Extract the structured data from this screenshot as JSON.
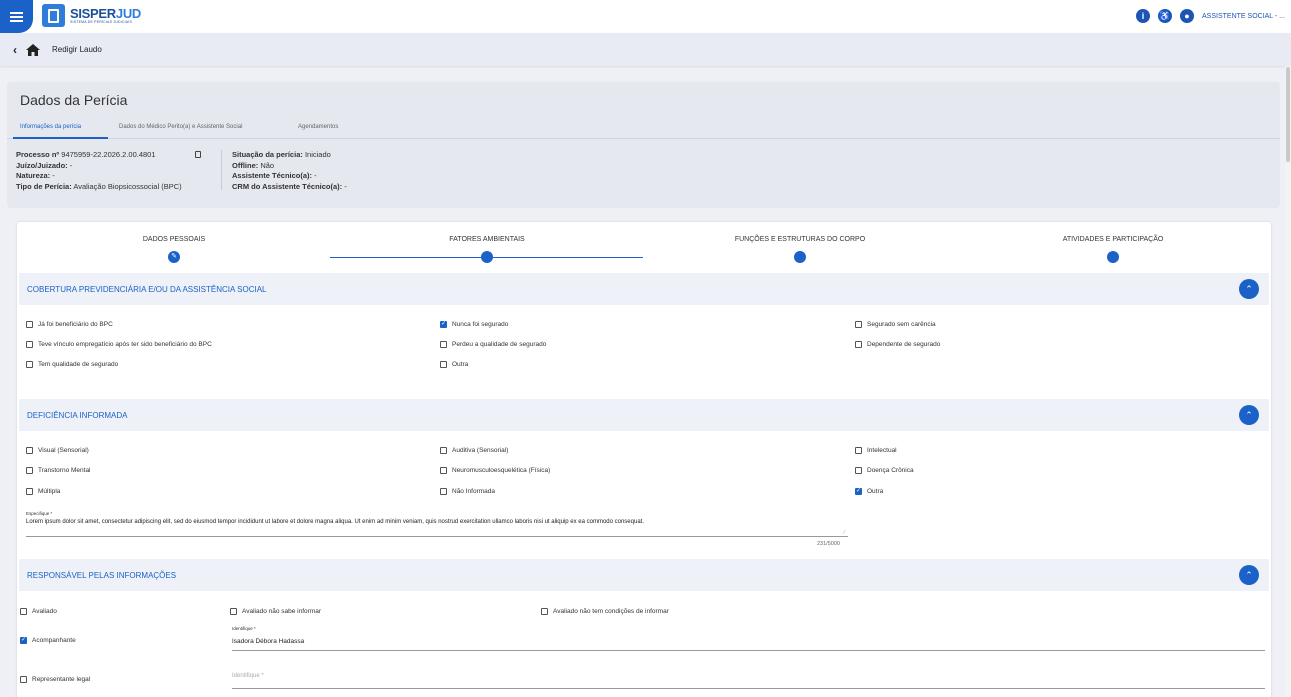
{
  "app": {
    "logo_main": "SISPER",
    "logo_accent": "JUD",
    "logo_sub": "SISTEMA DE PERÍCIAS JUDICIAIS",
    "user": "ASSISTENTE SOCIAL - ..."
  },
  "breadcrumb": {
    "back": "‹",
    "title": "Redigir Laudo"
  },
  "dados": {
    "title": "Dados da Perícia",
    "tabs": [
      "Informações da perícia",
      "Dados do Médico Perito(a) e Assistente Social",
      "Agendamentos"
    ],
    "left": [
      {
        "label": "Processo nº",
        "value": " 9475959-22.2026.2.00.4801"
      },
      {
        "label": "Juízo/Juizado:",
        "value": " -"
      },
      {
        "label": "Natureza:",
        "value": " -"
      },
      {
        "label": "Tipo de Perícia:",
        "value": " Avaliação Biopsicossocial (BPC)"
      }
    ],
    "right": [
      {
        "label": "Situação da perícia:",
        "value": " Iniciado"
      },
      {
        "label": "Offline:",
        "value": " Não"
      },
      {
        "label": "Assistente Técnico(a):",
        "value": " -"
      },
      {
        "label": "CRM do Assistente Técnico(a):",
        "value": " -"
      }
    ]
  },
  "steps": [
    "DADOS PESSOAIS",
    "FATORES AMBIENTAIS",
    "FUNÇÕES E ESTRUTURAS DO CORPO",
    "ATIVIDADES E PARTICIPAÇÃO"
  ],
  "sections": {
    "cobertura": {
      "title": "COBERTURA PREVIDENCIÁRIA E/OU DA ASSISTÊNCIA SOCIAL",
      "items": [
        {
          "label": "Já foi beneficiário do BPC",
          "checked": false
        },
        {
          "label": "Nunca foi segurado",
          "checked": true
        },
        {
          "label": "Segurado sem carência",
          "checked": false
        },
        {
          "label": "Teve vínculo empregatício após ter sido beneficiário do BPC",
          "checked": false
        },
        {
          "label": "Perdeu a qualidade de segurado",
          "checked": false
        },
        {
          "label": "Dependente de segurado",
          "checked": false
        },
        {
          "label": "Tem qualidade de segurado",
          "checked": false
        },
        {
          "label": "Outra",
          "checked": false
        }
      ]
    },
    "deficiencia": {
      "title": "DEFICIÊNCIA INFORMADA",
      "items": [
        {
          "label": "Visual (Sensorial)",
          "checked": false
        },
        {
          "label": "Auditiva (Sensorial)",
          "checked": false
        },
        {
          "label": "Intelectual",
          "checked": false
        },
        {
          "label": "Transtorno Mental",
          "checked": false
        },
        {
          "label": "Neuromusculoesquelética (Física)",
          "checked": false
        },
        {
          "label": "Doença Crônica",
          "checked": false
        },
        {
          "label": "Múltipla",
          "checked": false
        },
        {
          "label": "Não Informada",
          "checked": false
        },
        {
          "label": "Outra",
          "checked": true
        }
      ],
      "especifique_label": "Especifique *",
      "especifique_value": "Lorem ipsum dolor sit amet, consectetur adipiscing elit, sed do eiusmod tempor incididunt ut labore et dolore magna aliqua. Ut enim ad minim veniam, quis nostrud exercitation ullamco laboris nisi ut aliquip ex ea commodo consequat.",
      "counter": "231/5000"
    },
    "responsavel": {
      "title": "RESPONSÁVEL PELAS INFORMAÇÕES",
      "items": [
        {
          "label": "Avaliado",
          "checked": false
        },
        {
          "label": "Avaliado não sabe informar",
          "checked": false
        },
        {
          "label": "Avaliado não tem condições de informar",
          "checked": false
        },
        {
          "label": "Acompanhante",
          "checked": true
        },
        {
          "label": "Representante legal",
          "checked": false
        }
      ],
      "identifique_label": "Identifique *",
      "identifique_value": "Isadora Débora Hadassa",
      "identifique_placeholder": "Identifique *"
    }
  }
}
